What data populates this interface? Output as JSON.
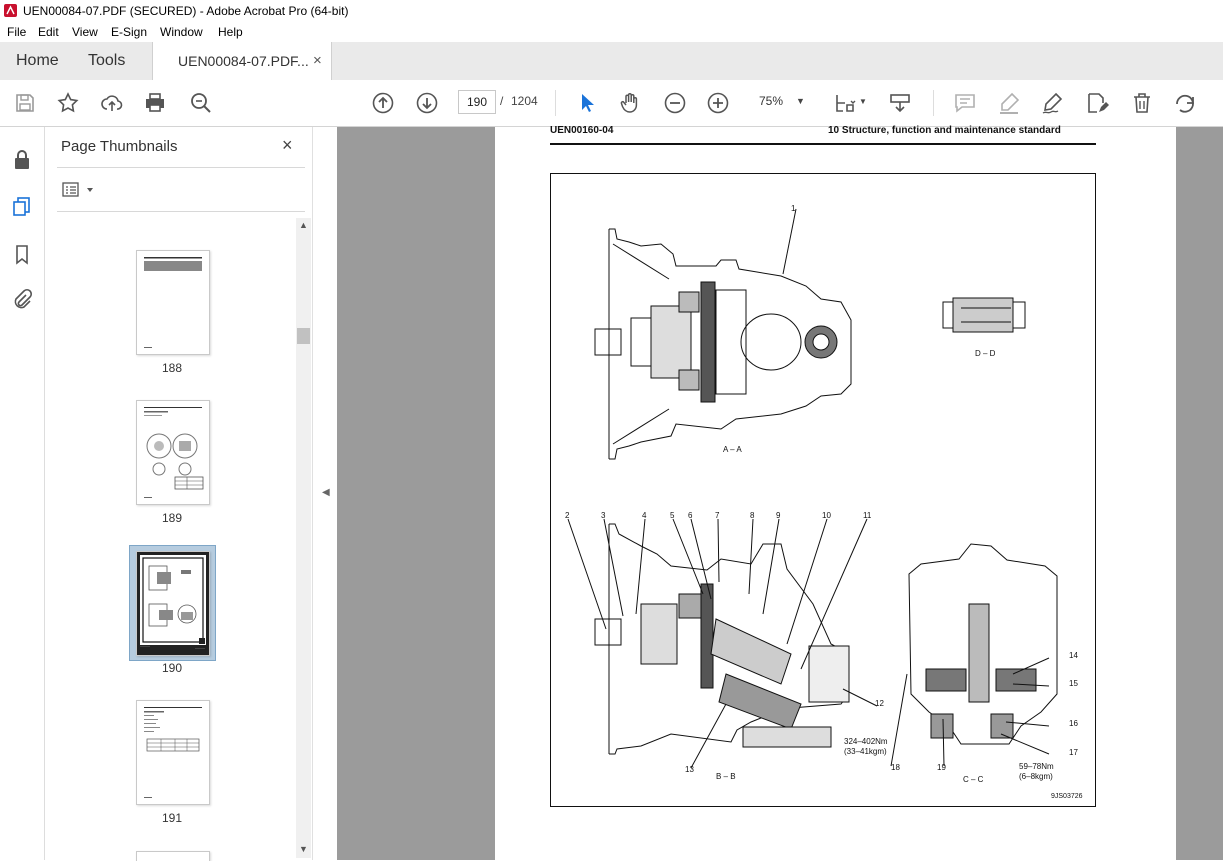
{
  "window": {
    "title": "UEN00084-07.PDF (SECURED) - Adobe Acrobat Pro (64-bit)"
  },
  "menu": [
    "File",
    "Edit",
    "View",
    "E-Sign",
    "Window",
    "Help"
  ],
  "tabs": {
    "home": "Home",
    "tools": "Tools",
    "document": "UEN00084-07.PDF...",
    "close_glyph": "×"
  },
  "toolbar": {
    "current_page": "190",
    "page_separator": "/",
    "total_pages": "1204",
    "zoom": "75%",
    "icons": [
      "save-icon",
      "bookmark-star-icon",
      "share-upload-icon",
      "print-icon",
      "search-zoom-icon",
      "previous-page-icon",
      "next-page-icon",
      "select-cursor-icon",
      "hand-pan-icon",
      "zoom-out-icon",
      "zoom-in-icon",
      "page-fit-icon",
      "scroll-mode-icon",
      "comment-icon",
      "highlight-icon",
      "sign-icon",
      "edit-text-icon",
      "delete-icon",
      "rotate-icon"
    ]
  },
  "sidebar": {
    "title": "Page Thumbnails",
    "close_glyph": "×",
    "thumbnails": [
      {
        "label": "188",
        "selected": false
      },
      {
        "label": "189",
        "selected": false
      },
      {
        "label": "190",
        "selected": true
      },
      {
        "label": "191",
        "selected": false
      }
    ]
  },
  "document": {
    "header_left": "UEN00160-04",
    "header_right": "10 Structure, function and maintenance standard",
    "labels": {
      "aa": "A – A",
      "dd": "D – D",
      "bb": "B – B",
      "cc": "C – C",
      "torque1": "324–402Nm",
      "torque1b": "(33–41kgm)",
      "torque2": "59–78Nm",
      "torque2b": "(6–8kgm)",
      "figcode": "9JS03726"
    },
    "callouts": [
      "1",
      "2",
      "3",
      "4",
      "5",
      "6",
      "7",
      "8",
      "9",
      "10",
      "11",
      "12",
      "13",
      "14",
      "15",
      "16",
      "17",
      "18",
      "19"
    ]
  }
}
